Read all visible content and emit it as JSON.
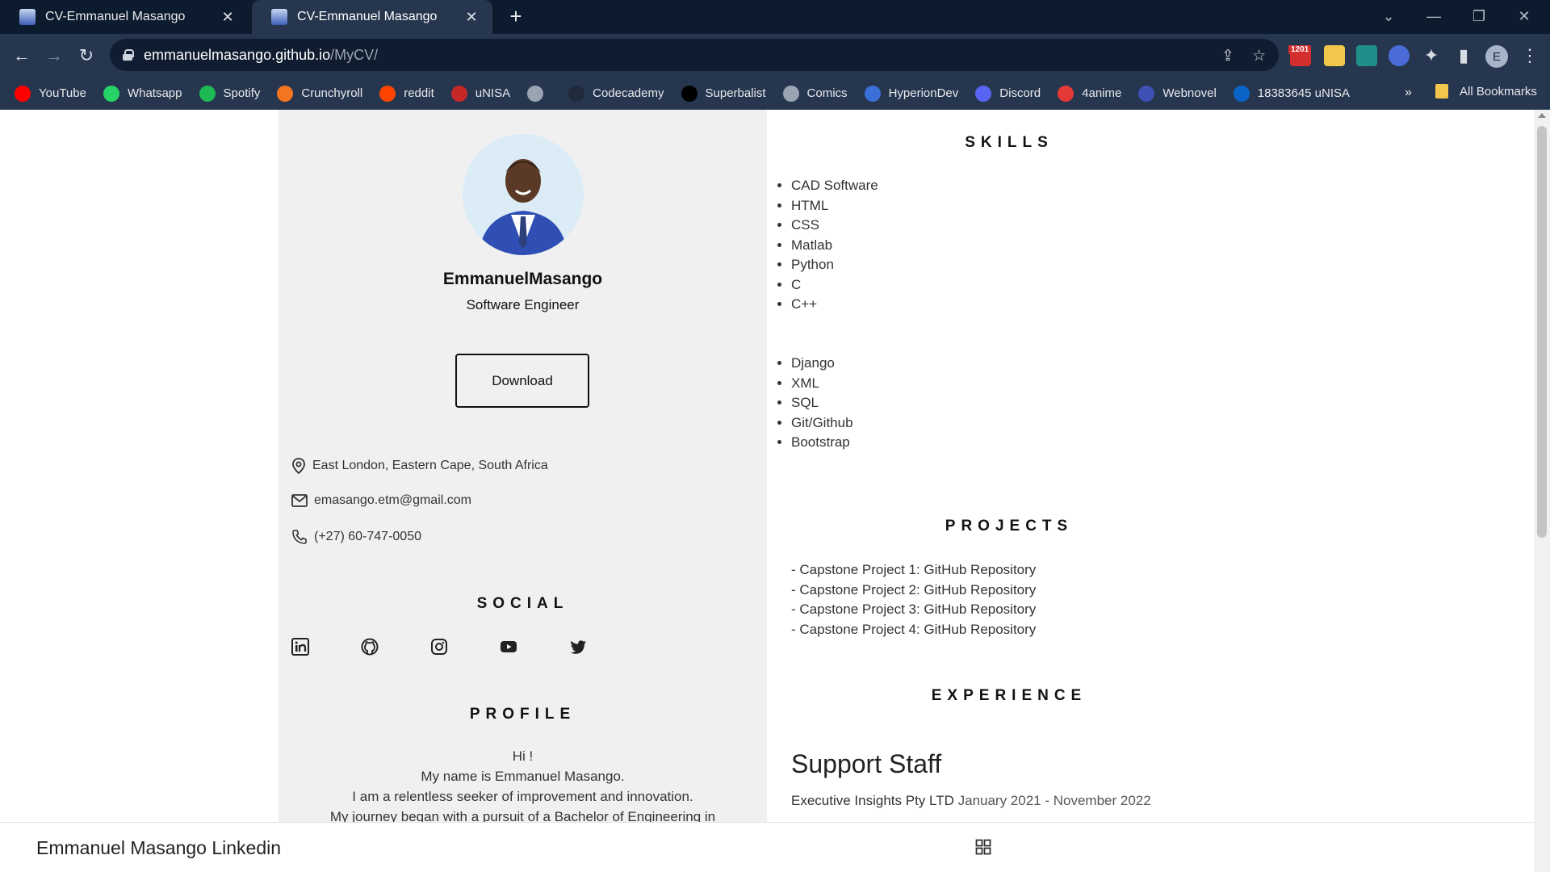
{
  "browser": {
    "tabs": [
      {
        "title": "CV-Emmanuel Masango",
        "active": false
      },
      {
        "title": "CV-Emmanuel Masango",
        "active": true
      }
    ],
    "url_host": "emmanuelmasango.github.io",
    "url_path": "/MyCV/",
    "extension_badge": "1201",
    "profile_initial": "E",
    "bookmarks": [
      {
        "label": "YouTube",
        "icon": "youtube-icon",
        "color": "#ff0000"
      },
      {
        "label": "Whatsapp",
        "icon": "whatsapp-icon",
        "color": "#25d366"
      },
      {
        "label": "Spotify",
        "icon": "spotify-icon",
        "color": "#1db954"
      },
      {
        "label": "Crunchyroll",
        "icon": "crunchyroll-icon",
        "color": "#f47521"
      },
      {
        "label": "reddit",
        "icon": "reddit-icon",
        "color": "#ff4500"
      },
      {
        "label": "uNISA",
        "icon": "unisa-icon",
        "color": "#c62828"
      },
      {
        "label": "",
        "icon": "globe-icon",
        "color": "#9aa3b1"
      },
      {
        "label": "Codecademy",
        "icon": "codecademy-icon",
        "color": "#1f2a3c"
      },
      {
        "label": "Superbalist",
        "icon": "superbalist-icon",
        "color": "#000000"
      },
      {
        "label": "Comics",
        "icon": "globe-icon",
        "color": "#9aa3b1"
      },
      {
        "label": "HyperionDev",
        "icon": "hyperiondev-icon",
        "color": "#3b6fd8"
      },
      {
        "label": "Discord",
        "icon": "discord-icon",
        "color": "#5865f2"
      },
      {
        "label": "4anime",
        "icon": "4anime-icon",
        "color": "#e53935"
      },
      {
        "label": "Webnovel",
        "icon": "webnovel-icon",
        "color": "#3f51b5"
      },
      {
        "label": "18383645 uNISA",
        "icon": "outlook-icon",
        "color": "#0a64c8"
      }
    ],
    "more_bookmarks": "»",
    "all_bookmarks": "All Bookmarks"
  },
  "cv": {
    "name": "EmmanuelMasango",
    "role": "Software Engineer",
    "download_label": "Download",
    "contact": {
      "location": "East London, Eastern Cape, South Africa",
      "email": "emasango.etm@gmail.com",
      "phone": "(+27) 60-747-0050"
    },
    "social_heading": "SOCIAL",
    "social_icons": [
      "linkedin-icon",
      "github-icon",
      "instagram-icon",
      "youtube-icon",
      "twitter-icon"
    ],
    "profile_heading": "PROFILE",
    "profile_lines": [
      "Hi !",
      "My name is Emmanuel Masango.",
      "I am a relentless seeker of improvement and innovation.",
      "My journey began with a pursuit of a Bachelor of Engineering in"
    ],
    "skills_heading": "SKILLS",
    "skills_primary": [
      "CAD Software",
      "HTML",
      "CSS",
      "Matlab",
      "Python",
      "C",
      "C++"
    ],
    "skills_secondary": [
      "Django",
      "XML",
      "SQL",
      "Git/Github",
      "Bootstrap"
    ],
    "projects_heading": "PROJECTS",
    "projects": [
      "- Capstone Project 1: GitHub Repository",
      "- Capstone Project 2: GitHub Repository",
      "- Capstone Project 3: GitHub Repository",
      "- Capstone Project 4: GitHub Repository"
    ],
    "experience_heading": "EXPERIENCE",
    "experience": {
      "title": "Support Staff",
      "company": "Executive Insights Pty LTD",
      "dates": "January 2021 - November 2022"
    }
  },
  "bottom_bar": {
    "title": "Emmanuel Masango Linkedin"
  }
}
